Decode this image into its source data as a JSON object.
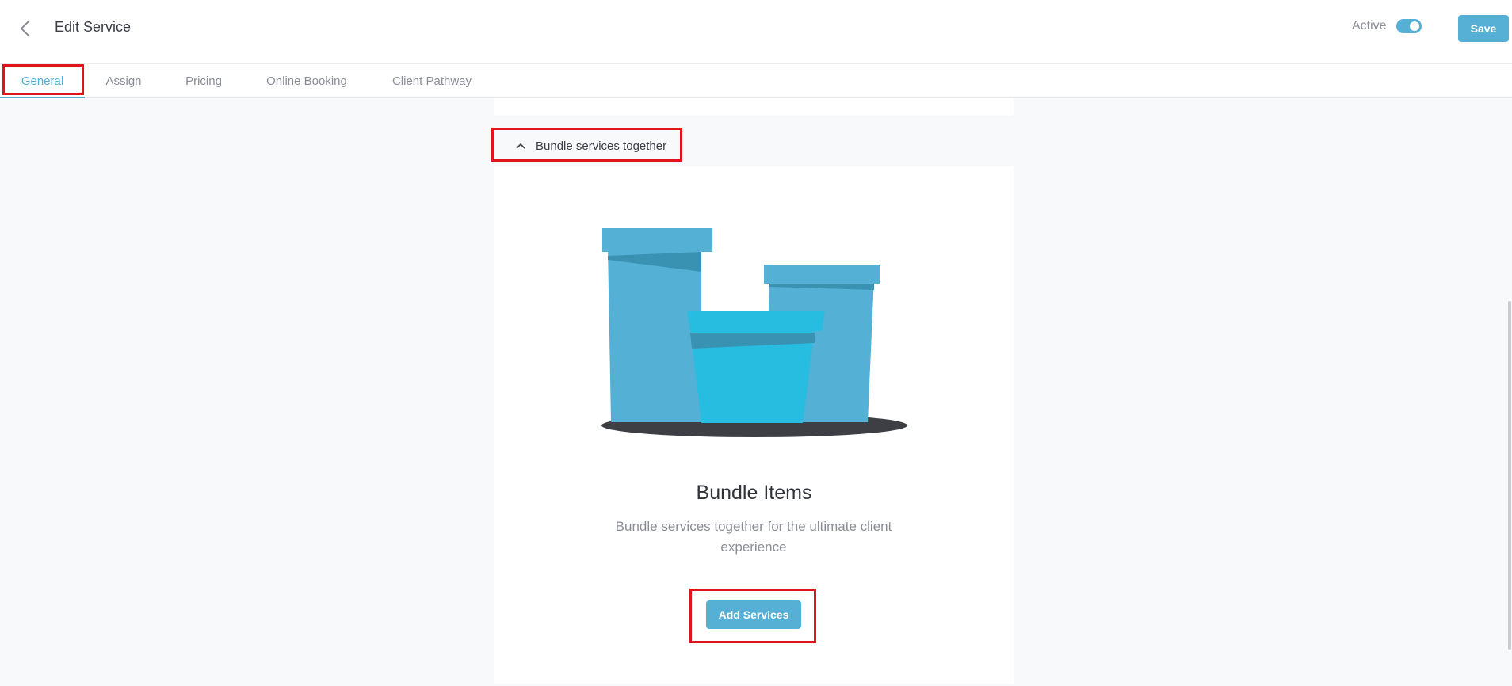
{
  "colors": {
    "accent": "#56b0d6",
    "highlight": "#e0141b"
  },
  "header": {
    "back_icon": "chevron-left-icon",
    "title": "Edit Service",
    "active_label": "Active",
    "active_on": true,
    "save_label": "Save"
  },
  "tabs": [
    {
      "label": "General",
      "active": true
    },
    {
      "label": "Assign",
      "active": false
    },
    {
      "label": "Pricing",
      "active": false
    },
    {
      "label": "Online Booking",
      "active": false
    },
    {
      "label": "Client Pathway",
      "active": false
    }
  ],
  "bundle": {
    "section_icon": "chevron-up-icon",
    "section_title": "Bundle services together",
    "illustration": "boxes-illustration",
    "heading": "Bundle Items",
    "description": "Bundle services together for the ultimate client experience",
    "add_label": "Add Services"
  }
}
